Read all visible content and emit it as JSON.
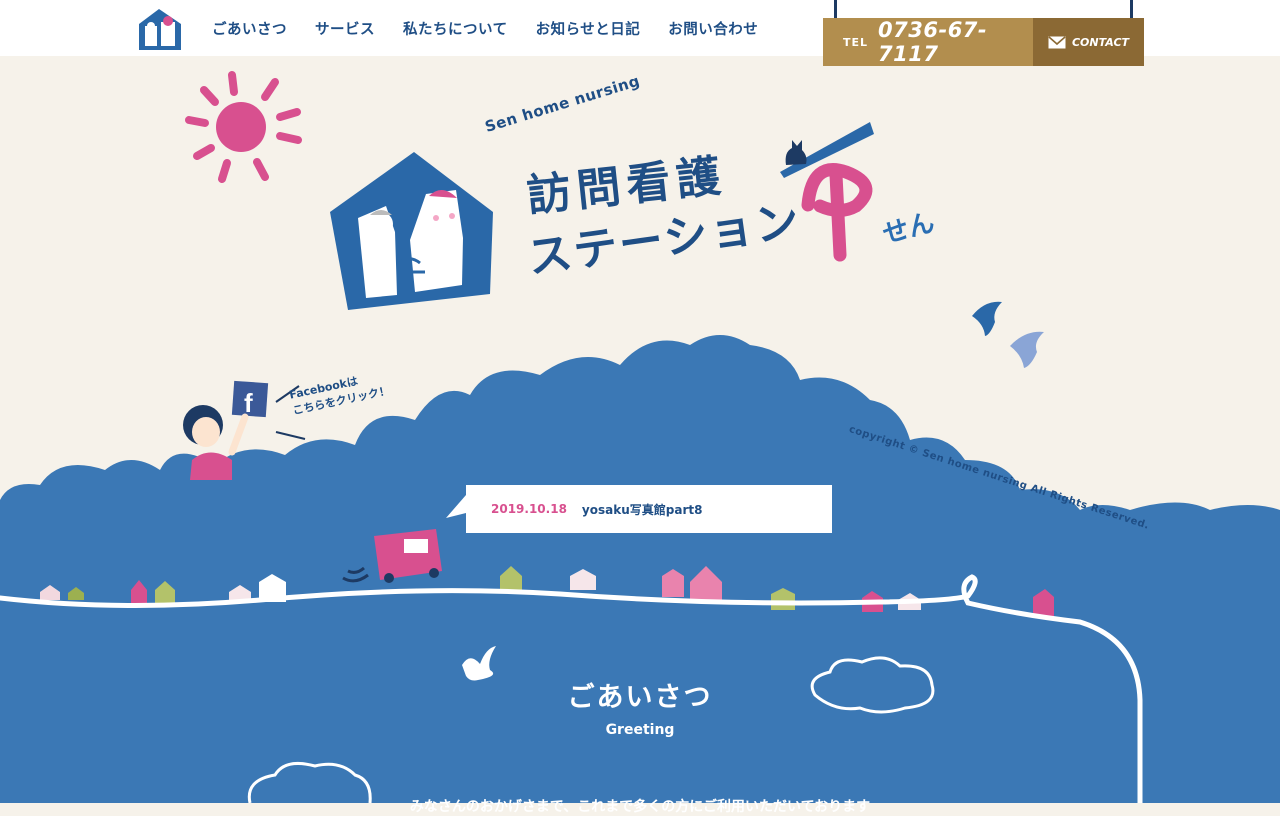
{
  "nav": {
    "items": [
      "ごあいさつ",
      "サービス",
      "私たちについて",
      "お知らせと日記",
      "お問い合わせ"
    ]
  },
  "contact": {
    "tel_label": "TEL",
    "tel_number": "0736-67-7117",
    "contact_label": "CONTACT"
  },
  "brand": {
    "english": "Sen home nursing",
    "line1": "訪問看護",
    "line2": "ステーション",
    "sen": "せん"
  },
  "facebook": {
    "line1": "Facebookは",
    "line2": "こちらをクリック！"
  },
  "copyright": "copyright © Sen home nursing All Rights Reserved.",
  "news": {
    "date": "2019.10.18",
    "title": "yosaku写真館part8"
  },
  "greeting": {
    "title": "ごあいさつ",
    "subtitle": "Greeting",
    "body": "みなさんのおかげさまで、これまで多くの方にご利用いただいております"
  },
  "colors": {
    "brand_blue": "#1f4e85",
    "sky_blue": "#3b78b5",
    "pink": "#d8508f",
    "gold": "#b28e4e"
  },
  "icons": [
    "logo-house-icon",
    "sun-icon",
    "cat-icon",
    "bird-icon",
    "facebook-icon",
    "mail-icon",
    "truck-icon"
  ]
}
